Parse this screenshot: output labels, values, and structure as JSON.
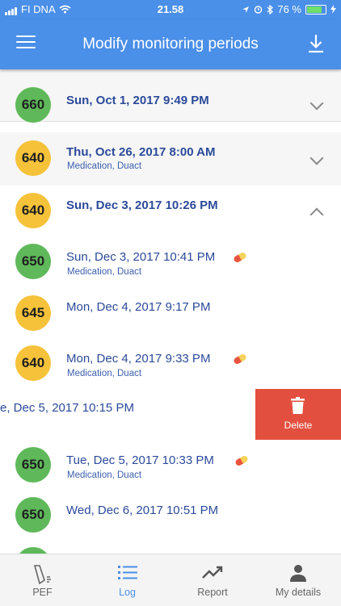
{
  "status_bar": {
    "carrier": "FI DNA",
    "time": "21.58",
    "battery": "76 %"
  },
  "header": {
    "title": "Modify monitoring periods"
  },
  "entries": [
    {
      "value": "660",
      "color": "green",
      "date": "Sun, Oct 1, 2017 9:49 PM",
      "note": "",
      "kind": "group",
      "expanded": false
    },
    {
      "value": "640",
      "color": "yellow",
      "date": "Thu, Oct 26, 2017 8:00 AM",
      "note": "Medication, Duact",
      "kind": "group",
      "expanded": false
    },
    {
      "value": "640",
      "color": "yellow",
      "date": "Sun, Dec 3, 2017 10:26 PM",
      "note": "",
      "kind": "group",
      "expanded": true
    },
    {
      "value": "650",
      "color": "green",
      "date": "Sun, Dec 3, 2017 10:41 PM",
      "note": "Medication, Duact",
      "kind": "item",
      "medication_icon": true
    },
    {
      "value": "645",
      "color": "yellow",
      "date": "Mon, Dec 4, 2017 9:17 PM",
      "note": "",
      "kind": "item",
      "medication_icon": false
    },
    {
      "value": "640",
      "color": "yellow",
      "date": "Mon, Dec 4, 2017 9:33 PM",
      "note": "Medication, Duact",
      "kind": "item",
      "medication_icon": true
    },
    {
      "value": "",
      "color": "",
      "date": "e, Dec 5, 2017 10:15 PM",
      "note": "",
      "kind": "swiped"
    },
    {
      "value": "650",
      "color": "green",
      "date": "Tue, Dec 5, 2017 10:33 PM",
      "note": "Medication, Duact",
      "kind": "item",
      "medication_icon": true
    },
    {
      "value": "650",
      "color": "green",
      "date": "Wed, Dec 6, 2017 10:51 PM",
      "note": "",
      "kind": "item",
      "medication_icon": false
    }
  ],
  "swipe_action": {
    "label": "Delete",
    "color": "#e34f3f",
    "icon": "trash-icon"
  },
  "colors": {
    "accent": "#4a8fe8",
    "green": "#5fb95a",
    "yellow": "#f5c23a",
    "text": "#2b4a9a"
  },
  "tabs": [
    {
      "label": "PEF",
      "icon": "peak-flow-meter-icon",
      "active": false
    },
    {
      "label": "Log",
      "icon": "list-icon",
      "active": true
    },
    {
      "label": "Report",
      "icon": "trend-icon",
      "active": false
    },
    {
      "label": "My details",
      "icon": "person-icon",
      "active": false
    }
  ]
}
